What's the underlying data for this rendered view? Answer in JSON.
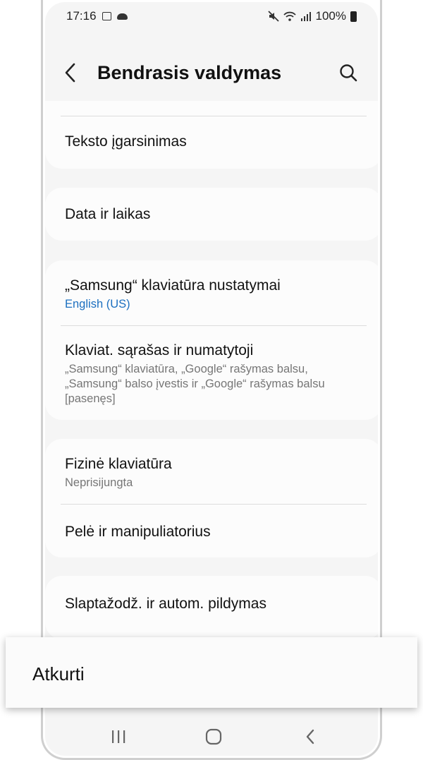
{
  "status": {
    "time": "17:16",
    "battery": "100%"
  },
  "header": {
    "title": "Bendrasis valdymas"
  },
  "items": {
    "tts": {
      "title": "Teksto įgarsinimas"
    },
    "datetime": {
      "title": "Data ir laikas"
    },
    "samsung_kb": {
      "title": "„Samsung“ klaviatūra nustatymai",
      "subtitle": "English (US)"
    },
    "kb_list": {
      "title": "Klaviat. sąrašas ir numatytoji",
      "subtitle_1": "„Samsung“ klaviatūra, „Google“ rašymas balsu,",
      "subtitle_2": "„Samsung“ balso įvestis ir „Google“ rašymas balsu",
      "subtitle_3": "[pasenęs]"
    },
    "physical_kb": {
      "title": "Fizinė klaviatūra",
      "subtitle": "Neprisijungta"
    },
    "mouse": {
      "title": "Pelė ir manipuliatorius"
    },
    "passwords": {
      "title": "Slaptažodž. ir autom. pildymas"
    }
  },
  "toast": {
    "label": "Atkurti"
  },
  "colors": {
    "accent": "#1b6fc0",
    "card": "#fcfcfc",
    "background": "#f5f5f5"
  }
}
